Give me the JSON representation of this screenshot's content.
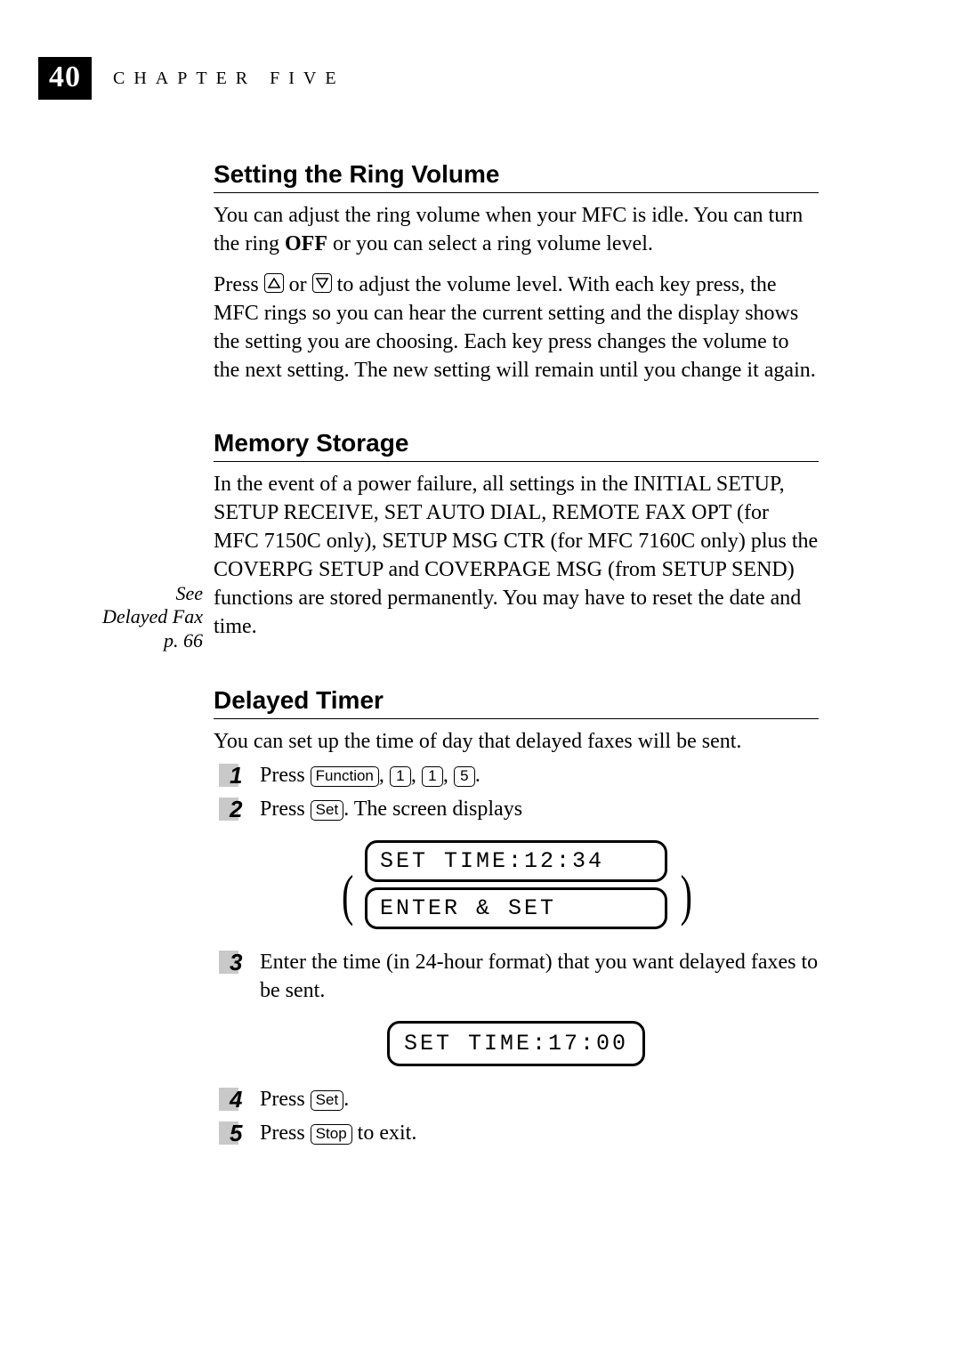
{
  "page_number": "40",
  "chapter_label": "CHAPTER FIVE",
  "margin_note": {
    "line1": "See",
    "line2": "Delayed Fax",
    "line3": "p. 66"
  },
  "keys": {
    "function": "Function",
    "k1": "1",
    "k5": "5",
    "set": "Set",
    "stop": "Stop"
  },
  "sections": {
    "ring": {
      "title": "Setting the Ring Volume",
      "p1a": "You can adjust the ring volume when your MFC is idle. You can turn the ring ",
      "p1_bold": "OFF",
      "p1b": " or you can select a ring volume level.",
      "p2a": "Press ",
      "p2b": " or ",
      "p2c": " to adjust the volume level. With each key press, the MFC rings so you can hear the current setting and the display shows the setting you are choosing. Each key press changes the volume to the next setting. The new setting will remain until you change it again."
    },
    "memory": {
      "title": "Memory Storage",
      "p1": "In the event of a power failure, all settings in the INITIAL SETUP, SETUP RECEIVE, SET AUTO DIAL, REMOTE FAX OPT (for MFC 7150C only), SETUP MSG CTR (for MFC 7160C only) plus the COVERPG SETUP and COVERPAGE MSG (from SETUP SEND) functions are stored permanently. You may have to reset the date and time."
    },
    "delayed": {
      "title": "Delayed Timer",
      "intro": "You can set up the time of day that delayed faxes will be sent.",
      "step1_a": "Press ",
      "step1_b": ", ",
      "step1_c": ", ",
      "step1_d": ", ",
      "step1_e": ".",
      "step2_a": "Press ",
      "step2_b": ". The screen displays",
      "lcd1_line1": "SET TIME:12:34",
      "lcd1_line2": "ENTER & SET",
      "step3": "Enter the time (in 24-hour format) that you want delayed faxes to be sent.",
      "lcd2": "SET TIME:17:00",
      "step4_a": "Press ",
      "step4_b": ".",
      "step5_a": "Press ",
      "step5_b": " to exit."
    }
  },
  "step_nums": {
    "n1": "1",
    "n2": "2",
    "n3": "3",
    "n4": "4",
    "n5": "5"
  }
}
